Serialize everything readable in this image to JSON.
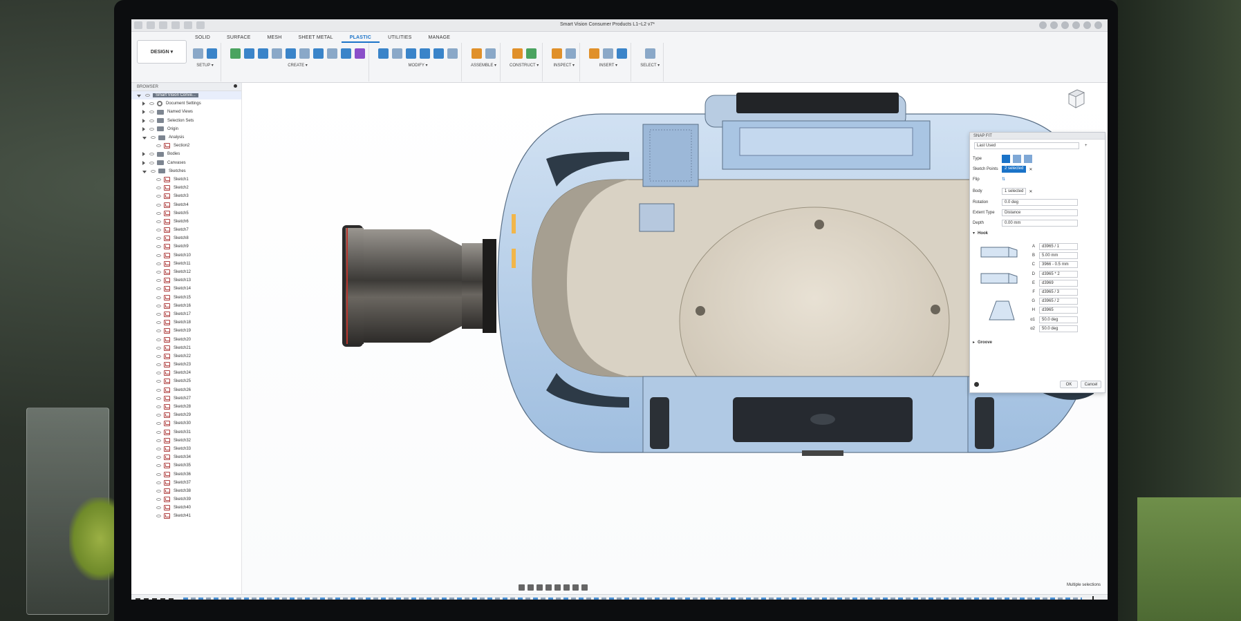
{
  "window": {
    "title": "Smart Vision Consumer Products L1~L2 v7*"
  },
  "ribbon": {
    "workspace_label": "DESIGN ▾",
    "tabs": [
      "SOLID",
      "SURFACE",
      "MESH",
      "SHEET METAL",
      "PLASTIC",
      "UTILITIES",
      "MANAGE"
    ],
    "active_tab": "PLASTIC",
    "groups": [
      "SETUP ▾",
      "CREATE ▾",
      "MODIFY ▾",
      "ASSEMBLE ▾",
      "CONSTRUCT ▾",
      "INSPECT ▾",
      "INSERT ▾",
      "SELECT ▾"
    ]
  },
  "browser": {
    "header": "BROWSER",
    "root": "Smart Vision Conve...",
    "nodes": [
      {
        "label": "Document Settings",
        "type": "gear"
      },
      {
        "label": "Named Views",
        "type": "folder"
      },
      {
        "label": "Selection Sets",
        "type": "folder"
      },
      {
        "label": "Origin",
        "type": "folder"
      },
      {
        "label": "Analysis",
        "type": "folder"
      },
      {
        "label": "Section2",
        "type": "child"
      },
      {
        "label": "Bodies",
        "type": "folder"
      },
      {
        "label": "Canvases",
        "type": "folder"
      },
      {
        "label": "Sketches",
        "type": "folder"
      }
    ],
    "sketches": [
      "Sketch1",
      "Sketch2",
      "Sketch3",
      "Sketch4",
      "Sketch5",
      "Sketch6",
      "Sketch7",
      "Sketch8",
      "Sketch9",
      "Sketch10",
      "Sketch11",
      "Sketch12",
      "Sketch13",
      "Sketch14",
      "Sketch15",
      "Sketch16",
      "Sketch17",
      "Sketch18",
      "Sketch19",
      "Sketch20",
      "Sketch21",
      "Sketch22",
      "Sketch23",
      "Sketch24",
      "Sketch25",
      "Sketch26",
      "Sketch27",
      "Sketch28",
      "Sketch29",
      "Sketch30",
      "Sketch31",
      "Sketch32",
      "Sketch33",
      "Sketch34",
      "Sketch35",
      "Sketch36",
      "Sketch37",
      "Sketch38",
      "Sketch39",
      "Sketch40",
      "Sketch41"
    ]
  },
  "navcube": {
    "label": "RIGHT"
  },
  "snapfit": {
    "title": "SNAP FIT",
    "preset": "Last Used",
    "type_label": "Type",
    "sketch_points_label": "Sketch Points",
    "sketch_points_value": "2 selected",
    "flip_label": "Flip",
    "body_label": "Body",
    "body_value": "1 selected",
    "rotation_label": "Rotation",
    "rotation_value": "0.0 deg",
    "extent_label": "Extent Type",
    "extent_value": "Distance",
    "depth_label": "Depth",
    "depth_value": "0.00 mm",
    "hook_label": "Hook",
    "hook_params": [
      {
        "k": "A",
        "v": "d3965 / 1"
      },
      {
        "k": "B",
        "v": "5.00 mm"
      },
      {
        "k": "C",
        "v": "3966 - 0.5 mm"
      },
      {
        "k": "D",
        "v": "d3965 * 2"
      },
      {
        "k": "E",
        "v": "d3969"
      },
      {
        "k": "F",
        "v": "d3965 / 3"
      },
      {
        "k": "G",
        "v": "d3965 / 2"
      },
      {
        "k": "H",
        "v": "d3965"
      },
      {
        "k": "α1",
        "v": "50.0 deg"
      },
      {
        "k": "α2",
        "v": "50.0 deg"
      }
    ],
    "groove_label": "Groove",
    "ok_label": "OK",
    "cancel_label": "Cancel"
  },
  "status": {
    "text": "Multiple selections"
  },
  "colors": {
    "accent": "#1a73c8",
    "ribbon": "#f4f5f7",
    "part_blue": "#9dc3ea"
  }
}
